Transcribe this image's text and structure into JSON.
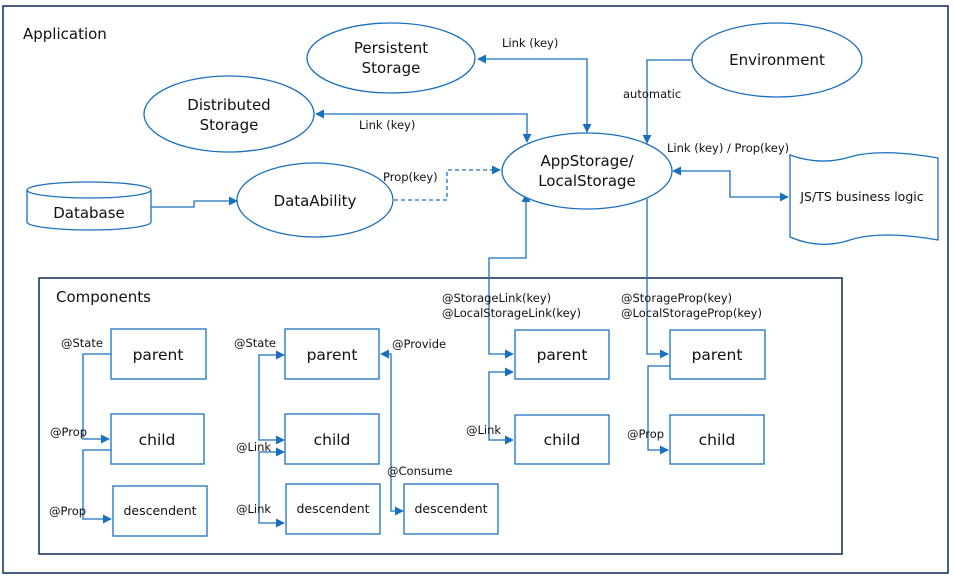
{
  "diagram": {
    "application_label": "Application",
    "components_label": "Components",
    "nodes": {
      "persistent_storage": [
        "Persistent",
        "Storage"
      ],
      "distributed_storage": [
        "Distributed",
        "Storage"
      ],
      "environment": "Environment",
      "database": "Database",
      "data_ability": "DataAbility",
      "app_storage": [
        "AppStorage/",
        "LocalStorage"
      ],
      "business_logic": "JS/TS business logic"
    },
    "edge_labels": {
      "persistent_link": "Link (key)",
      "distributed_link": "Link (key)",
      "environment_auto": "automatic",
      "data_ability_prop": "Prop(key)",
      "business_logic_link": "Link (key) / Prop(key)",
      "storage_link": [
        "@StorageLink(key)",
        "@LocalStorageLink(key)"
      ],
      "storage_prop": [
        "@StorageProp(key)",
        "@LocalStorageProp(key)"
      ]
    },
    "component_groups": [
      {
        "boxes": [
          "parent",
          "child",
          "descendent"
        ],
        "labels": [
          "@State",
          "@Prop",
          "@Prop"
        ]
      },
      {
        "boxes": [
          "parent",
          "child",
          "descendent"
        ],
        "labels": [
          "@State",
          "@Link",
          "@Link"
        ]
      },
      {
        "boxes": [
          "descendent"
        ],
        "labels": [
          "@Provide",
          "@Consume"
        ]
      },
      {
        "boxes": [
          "parent",
          "child"
        ],
        "labels": [
          "@Link"
        ]
      },
      {
        "boxes": [
          "parent",
          "child"
        ],
        "labels": [
          "@Prop"
        ]
      }
    ]
  }
}
